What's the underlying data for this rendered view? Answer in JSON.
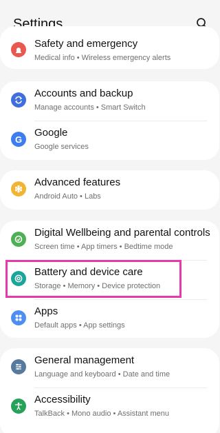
{
  "header": {
    "title": "Settings",
    "search_icon": "search-icon"
  },
  "groups": [
    {
      "items": [
        {
          "label": "Safety and emergency",
          "sub": "Medical info  •  Wireless emergency alerts",
          "icon": "safety-icon",
          "icon_color": "#e8594f"
        }
      ]
    },
    {
      "items": [
        {
          "label": "Accounts and backup",
          "sub": "Manage accounts  •  Smart Switch",
          "icon": "sync-icon",
          "icon_color": "#3f6fdc"
        },
        {
          "label": "Google",
          "sub": "Google services",
          "icon": "google-icon",
          "icon_color": "#3d7df0"
        }
      ]
    },
    {
      "items": [
        {
          "label": "Advanced features",
          "sub": "Android Auto  •  Labs",
          "icon": "advanced-features-icon",
          "icon_color": "#f2b533"
        }
      ]
    },
    {
      "items": [
        {
          "label": "Digital Wellbeing and parental controls",
          "sub": "Screen time  •  App timers  •  Bedtime mode",
          "icon": "wellbeing-icon",
          "icon_color": "#4eb055"
        },
        {
          "label": "Battery and device care",
          "sub": "Storage  •  Memory  •  Device protection",
          "icon": "battery-care-icon",
          "icon_color": "#1aa59a"
        },
        {
          "label": "Apps",
          "sub": "Default apps  •  App settings",
          "icon": "apps-icon",
          "icon_color": "#4d8ff0"
        }
      ]
    },
    {
      "items": [
        {
          "label": "General management",
          "sub": "Language and keyboard  •  Date and time",
          "icon": "general-management-icon",
          "icon_color": "#557a9e"
        },
        {
          "label": "Accessibility",
          "sub": "TalkBack  •  Mono audio  •  Assistant menu",
          "icon": "accessibility-icon",
          "icon_color": "#27a05a"
        }
      ]
    }
  ],
  "highlight_color": "#e63aaa"
}
